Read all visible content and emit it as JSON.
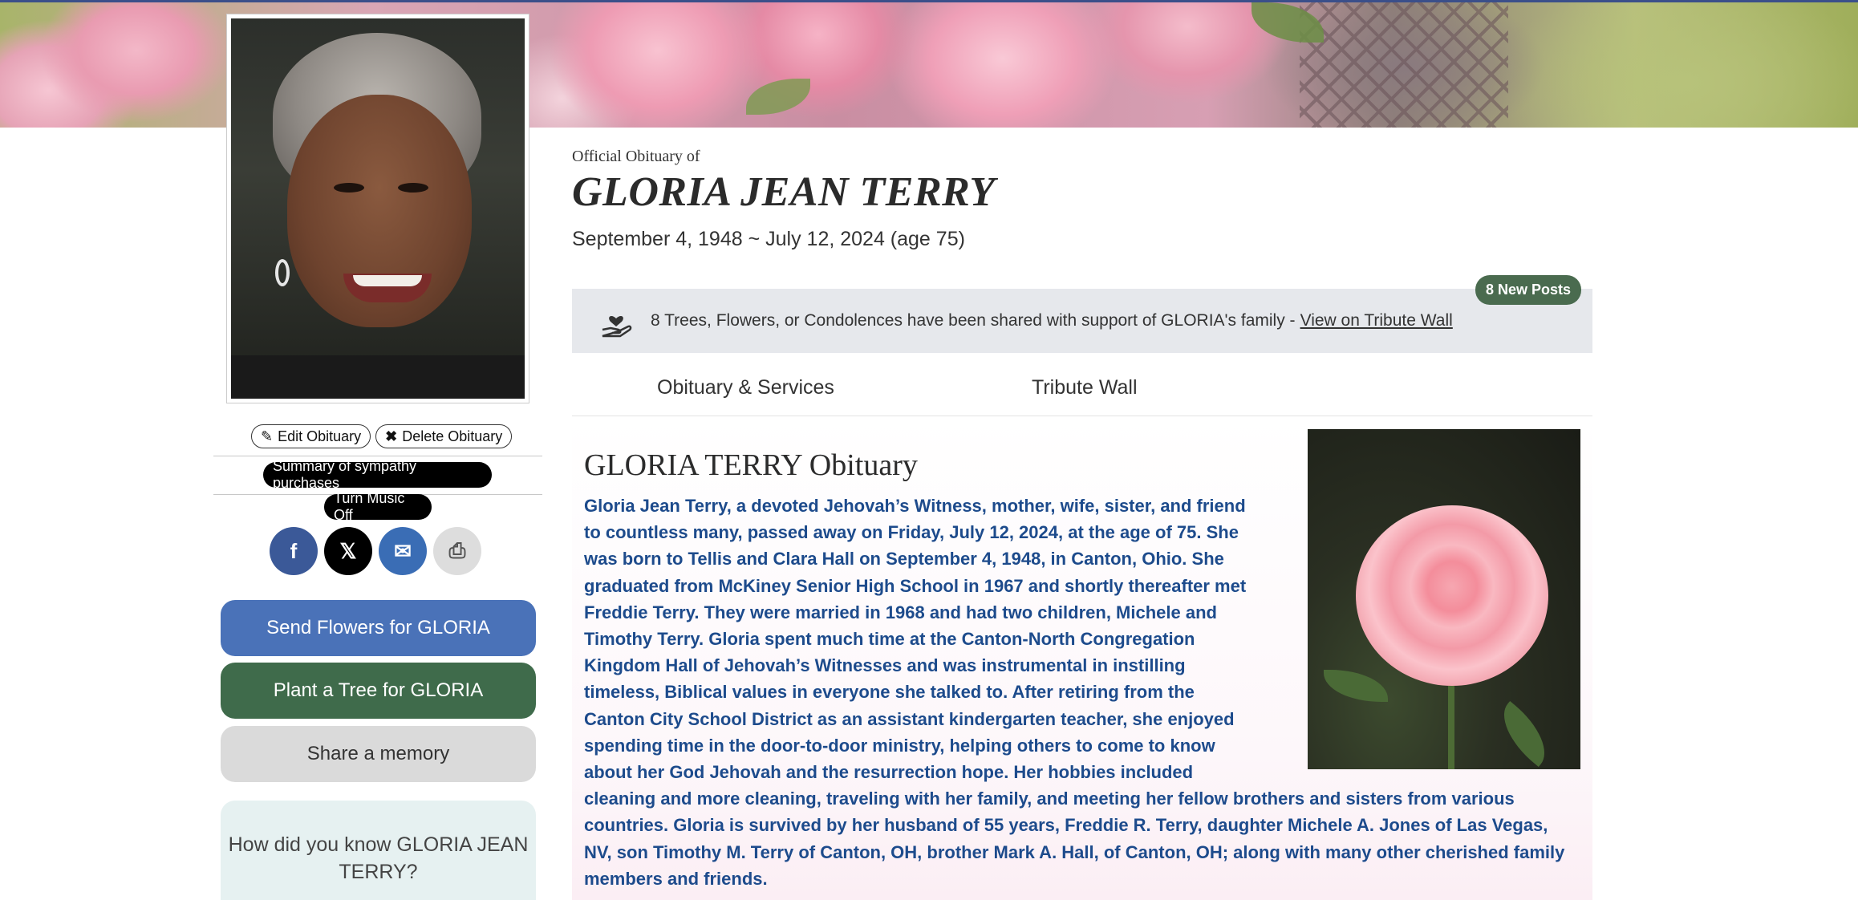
{
  "header": {
    "official_label": "Official Obituary of",
    "full_name": "GLORIA JEAN TERRY",
    "dates": "September 4, 1948 ~ July 12, 2024 (age 75)"
  },
  "admin": {
    "edit_label": "Edit Obituary",
    "delete_label": "Delete Obituary",
    "summary_label": "Summary of sympathy purchases",
    "music_label": "Turn Music Off"
  },
  "share": {
    "facebook": "f",
    "x": "𝕏",
    "email": "✉",
    "print": "⎙"
  },
  "actions": {
    "flowers": "Send Flowers for GLORIA",
    "tree": "Plant a Tree for GLORIA",
    "memory": "Share a memory"
  },
  "know_prompt": "How did you know GLORIA JEAN TERRY?",
  "tribute": {
    "message": "8 Trees, Flowers, or Condolences have been shared with support of GLORIA's family -",
    "link": "View on Tribute Wall",
    "new_posts": "8 New Posts"
  },
  "tabs": [
    {
      "label": "Obituary & Services"
    },
    {
      "label": "Tribute Wall"
    }
  ],
  "obituary": {
    "title": "GLORIA TERRY Obituary",
    "body": "Gloria Jean Terry, a devoted Jehovah’s Witness, mother, wife, sister, and friend to countless many, passed away on Friday, July 12, 2024, at the age of 75. She was born to Tellis and Clara Hall on September 4, 1948, in Canton, Ohio. She graduated from McKiney Senior High School in 1967 and shortly thereafter met Freddie Terry. They were married in 1968 and had two children, Michele and Timothy Terry. Gloria spent much time at the Canton-North Congregation Kingdom Hall of Jehovah’s Witnesses and was instrumental in instilling timeless, Biblical values in everyone she talked to. After retiring from the Canton City School District as an assistant kindergarten teacher, she enjoyed spending time in the door-to-door ministry, helping others to come to know about her God Jehovah and the resurrection hope. Her hobbies included cleaning and more cleaning, traveling with her family, and meeting her fellow brothers and sisters from various countries. Gloria is survived by her husband of 55 years, Freddie R. Terry, daughter Michele A. Jones of Las Vegas, NV, son Timothy M. Terry of Canton, OH, brother Mark A. Hall, of Canton, OH; along with many other cherished family members and friends."
  },
  "colors": {
    "facebook": "#3b5998",
    "x": "#000000",
    "email": "#3a6db5",
    "print": "#dddddd",
    "flowers_btn": "#4a72b8",
    "tree_btn": "#3f6b4b",
    "memory_btn": "#dadada",
    "obit_text": "#1d4b8c",
    "new_posts_badge": "#4a6b4f"
  }
}
